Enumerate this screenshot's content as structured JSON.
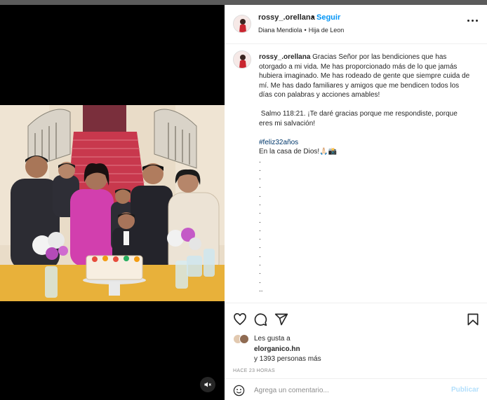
{
  "post": {
    "username": "rossy_.orellana",
    "dot": "•",
    "follow_label": "Seguir",
    "tagged_user": "Diana Mendiola",
    "location": "Hija de Leon",
    "caption": {
      "username": "rossy_.orellana",
      "p1": "Gracias Señor por las bendiciones que has otorgado a mi vida. Me has proporcionado más de lo que jamás hubiera imaginado. Me has rodeado de gente que siempre cuida de mí. Me has dado familiares y amigos que me bendicen todos los días con palabras y acciones amables!",
      "p2": " Salmo 118:21. ¡Te daré gracias porque me respondiste, porque eres mi salvación!",
      "hashtag": "#feliz32años",
      "p3": "En la casa de Dios!🙏🏻📸",
      "dots": ".\n.\n.\n.\n.\n.\n.\n.\n.\n.\n.\n.\n.\n.\n.\n..",
      "dot_lines": 16
    }
  },
  "likes": {
    "prefix": "Les gusta a",
    "user": "elorganico.hn",
    "suffix_pre": "y ",
    "count": "1393 personas más"
  },
  "time_ago": "HACE 23 HORAS",
  "comment": {
    "placeholder": "Agrega un comentario...",
    "publish_label": "Publicar"
  },
  "icons": {
    "more": "more-horizontal-icon",
    "like": "heart-icon",
    "comment": "comment-icon",
    "share": "share-icon",
    "save": "bookmark-icon",
    "emoji": "emoji-icon",
    "mute": "muted-speaker-icon"
  },
  "colors": {
    "link": "#0095f6",
    "publish_disabled": "#b2dffc",
    "hashtag": "#00376b",
    "muted_text": "#8e8e8e"
  }
}
